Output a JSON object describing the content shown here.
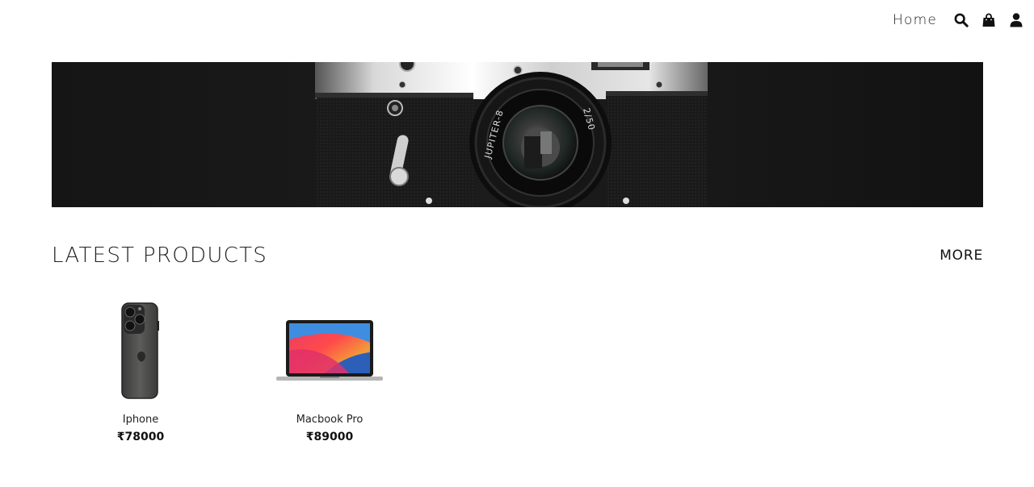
{
  "nav": {
    "home_label": "Home",
    "icons": [
      "search-icon",
      "shopping-bag-icon",
      "user-icon"
    ]
  },
  "hero": {
    "image": "vintage-camera-banner",
    "lens_text_left": "JUPITER-8",
    "lens_text_right": "2/50"
  },
  "section": {
    "title": "LATEST PRODUCTS",
    "more_label": "MORE"
  },
  "products": [
    {
      "name": "Iphone",
      "price": "₹78000",
      "image": "iphone-image"
    },
    {
      "name": "Macbook Pro",
      "price": "₹89000",
      "image": "macbook-image"
    }
  ]
}
